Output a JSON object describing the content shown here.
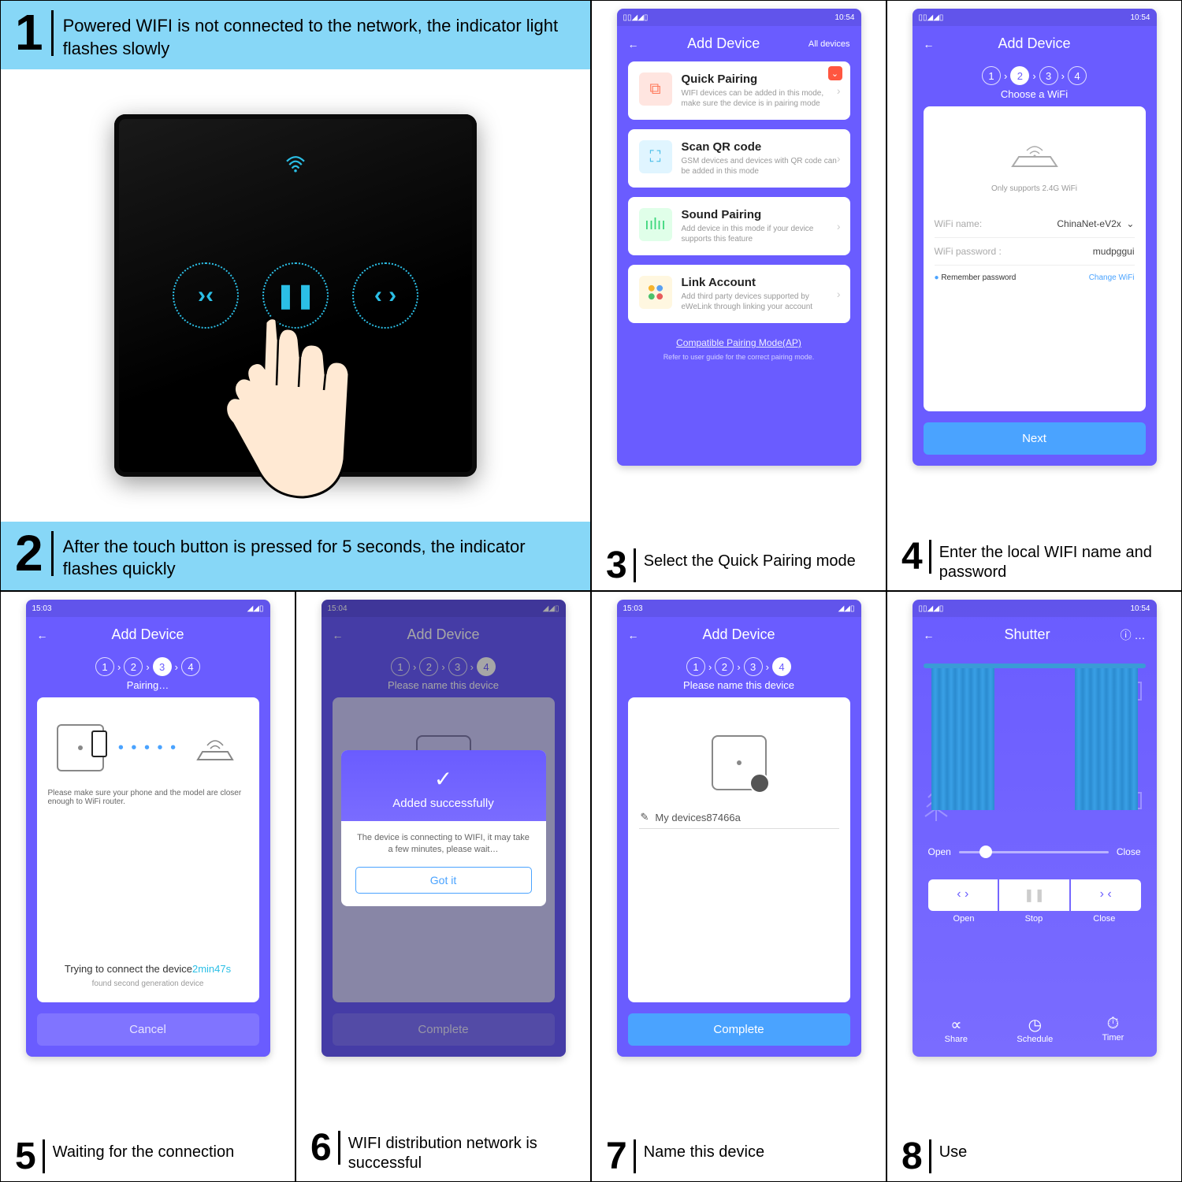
{
  "step1": {
    "num": "1",
    "text": "Powered WIFI is not connected to the network, the indicator light flashes slowly"
  },
  "step2": {
    "num": "2",
    "text": "After the touch button is pressed for 5 seconds, the indicator flashes quickly"
  },
  "step3": {
    "num": "3",
    "text": "Select the Quick Pairing mode",
    "screen": {
      "status_time": "10:54",
      "header": "Add Device",
      "all_devices": "All devices",
      "cards": [
        {
          "title": "Quick Pairing",
          "desc": "WIFI devices can be added in this mode, make sure the device is in pairing mode"
        },
        {
          "title": "Scan QR code",
          "desc": "GSM devices and devices with QR code can be added in this mode"
        },
        {
          "title": "Sound Pairing",
          "desc": "Add device in this mode if your device supports this feature"
        },
        {
          "title": "Link Account",
          "desc": "Add third party devices supported by eWeLink through linking your account"
        }
      ],
      "link": "Compatible Pairing Mode(AP)",
      "hint": "Refer to user guide for the correct pairing mode."
    }
  },
  "step4": {
    "num": "4",
    "text": "Enter the local WIFI name and password",
    "screen": {
      "status_time": "10:54",
      "header": "Add Device",
      "subtitle": "Choose a WiFi",
      "note": "Only supports 2.4G WiFi",
      "wifi_name_label": "WiFi name:",
      "wifi_name_value": "ChinaNet-eV2x",
      "wifi_pass_label": "WiFi password :",
      "wifi_pass_value": "mudpggui",
      "remember": "Remember password",
      "change": "Change WiFi",
      "next": "Next"
    }
  },
  "step5": {
    "num": "5",
    "text": "Waiting for the connection",
    "screen": {
      "status_time": "15:03",
      "header": "Add Device",
      "subtitle": "Pairing…",
      "note": "Please make sure your phone and the model are closer enough to WiFi router.",
      "trying_a": "Trying to connect the device",
      "trying_b": "2min47s",
      "found": "found second generation device",
      "cancel": "Cancel"
    }
  },
  "step6": {
    "num": "6",
    "text": "WIFI distribution network is successful",
    "screen": {
      "status_time": "15:04",
      "header": "Add Device",
      "subtitle": "Please name this device",
      "modal_title": "Added successfully",
      "modal_body": "The device is connecting to WIFI, it may take a few minutes, please wait…",
      "modal_btn": "Got it",
      "complete": "Complete"
    }
  },
  "step7": {
    "num": "7",
    "text": "Name this device",
    "screen": {
      "status_time": "15:03",
      "header": "Add Device",
      "subtitle": "Please name this device",
      "device_name": "My devices87466a",
      "complete": "Complete"
    }
  },
  "step8": {
    "num": "8",
    "text": "Use",
    "screen": {
      "status_time": "10:54",
      "header": "Shutter",
      "open": "Open",
      "close": "Close",
      "stop": "Stop",
      "share": "Share",
      "schedule": "Schedule",
      "timer": "Timer"
    }
  }
}
